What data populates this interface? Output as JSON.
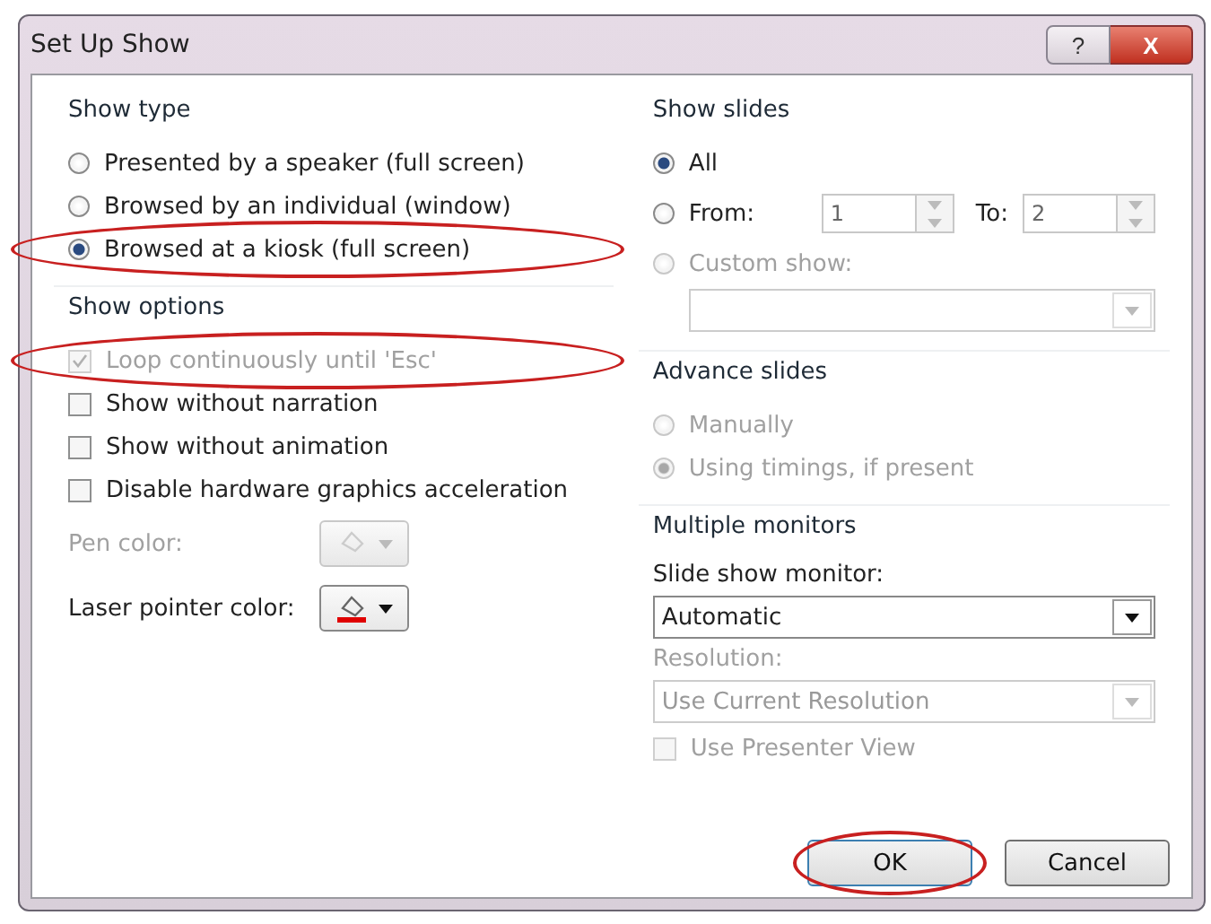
{
  "window": {
    "title": "Set Up Show",
    "help": "?",
    "close": "X"
  },
  "show_type": {
    "title": "Show type",
    "options": [
      {
        "label": "Presented by a speaker (full screen)",
        "selected": false,
        "circled": false
      },
      {
        "label": "Browsed by an individual (window)",
        "selected": false,
        "circled": false
      },
      {
        "label": "Browsed at a kiosk (full screen)",
        "selected": true,
        "circled": true
      }
    ]
  },
  "show_options": {
    "title": "Show options",
    "checkboxes": [
      {
        "label": "Loop continuously until 'Esc'",
        "checked": true,
        "disabled": true,
        "circled": true
      },
      {
        "label": "Show without narration",
        "checked": false,
        "disabled": false,
        "circled": false
      },
      {
        "label": "Show without animation",
        "checked": false,
        "disabled": false,
        "circled": false
      },
      {
        "label": "Disable hardware graphics acceleration",
        "checked": false,
        "disabled": false,
        "circled": false
      }
    ],
    "color_pickers": [
      {
        "label": "Pen color:",
        "disabled": true
      },
      {
        "label": "Laser pointer color:",
        "disabled": false,
        "color": "#e00000"
      }
    ]
  },
  "show_slides": {
    "title": "Show slides",
    "options": [
      {
        "kind": "plain",
        "label": "All",
        "selected": true,
        "disabled": false
      },
      {
        "kind": "range",
        "label": "From:",
        "selected": false,
        "disabled": false
      },
      {
        "kind": "custom",
        "label": "Custom show:",
        "selected": false,
        "disabled": true
      }
    ],
    "from_value": "1",
    "to_label": "To:",
    "to_value": "2"
  },
  "advance_slides": {
    "title": "Advance slides",
    "options": [
      {
        "label": "Manually",
        "selected": false,
        "disabled": true
      },
      {
        "label": "Using timings, if present",
        "selected": true,
        "disabled": true
      }
    ]
  },
  "multiple_monitors": {
    "title": "Multiple monitors",
    "monitor_label": "Slide show monitor:",
    "monitor_value": "Automatic",
    "resolution_label": "Resolution:",
    "resolution_value": "Use Current Resolution",
    "resolution_disabled": true,
    "presenter_view": {
      "label": "Use Presenter View",
      "checked": false,
      "disabled": true
    }
  },
  "buttons": [
    {
      "label": "OK",
      "default": true,
      "circled": true
    },
    {
      "label": "Cancel",
      "default": false,
      "circled": false
    }
  ]
}
